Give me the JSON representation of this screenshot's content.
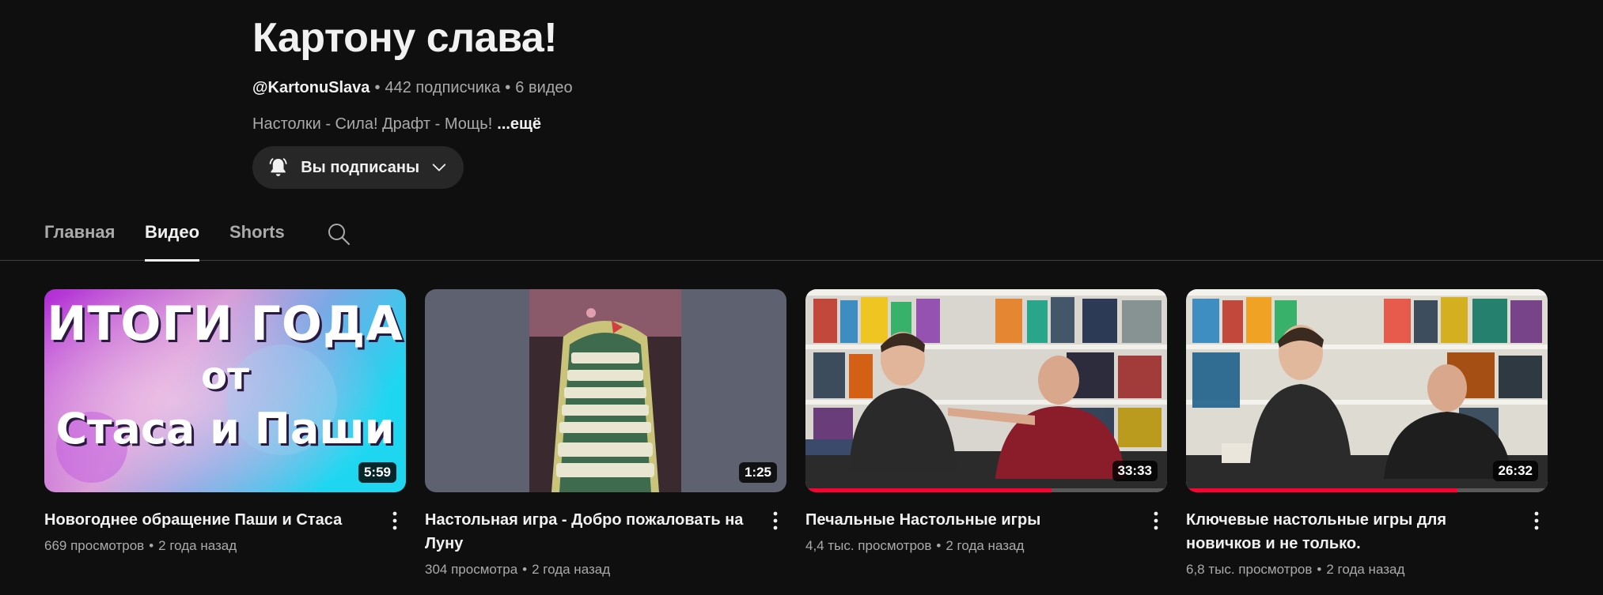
{
  "channel": {
    "title": "Картону слава!",
    "handle": "@KartonuSlava",
    "subscribers": "442 подписчика",
    "videos_count": "6 видео",
    "separator": "•",
    "description": "Настолки - Сила! Драфт - Мощь!",
    "more_label": "...ещё"
  },
  "subscribe": {
    "label": "Вы подписаны",
    "icon": "bell-icon"
  },
  "tabs": [
    {
      "label": "Главная"
    },
    {
      "label": "Видео"
    },
    {
      "label": "Shorts"
    }
  ],
  "active_tab": "Видео",
  "videos": [
    {
      "title": "Новогоднее обращение Паши и Стаса",
      "views": "669 просмотров",
      "age": "2 года назад",
      "duration": "5:59",
      "thumb_text": [
        "ИТОГИ ГОДА",
        "от",
        "Стаса и Паши"
      ],
      "progress": 0
    },
    {
      "title": "Настольная игра - Добро пожаловать на Луну",
      "views": "304 просмотра",
      "age": "2 года назад",
      "duration": "1:25",
      "progress": 0
    },
    {
      "title": "Печальные Настольные игры",
      "views": "4,4 тыс. просмотров",
      "age": "2 года назад",
      "duration": "33:33",
      "progress": 0.68
    },
    {
      "title": "Ключевые настольные игры для новичков и не только.",
      "views": "6,8 тыс. просмотров",
      "age": "2 года назад",
      "duration": "26:32",
      "progress": 0.75
    }
  ],
  "colors": {
    "background": "#0f0f0f",
    "progress": "#ff0033",
    "secondary_text": "#aaaaaa"
  }
}
